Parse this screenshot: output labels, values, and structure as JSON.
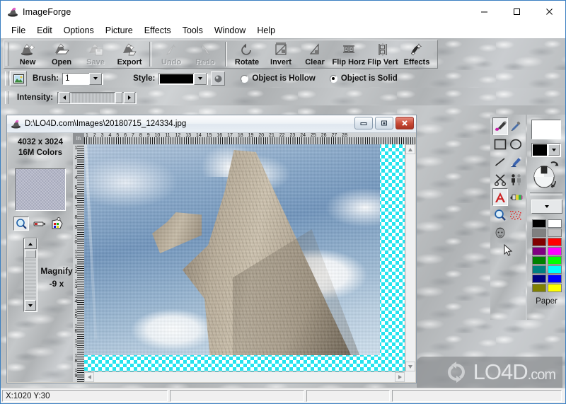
{
  "app": {
    "title": "ImageForge",
    "icon": "imageforge-logo-icon"
  },
  "window_controls": {
    "minimize": "—",
    "maximize": "☐",
    "close": "✕"
  },
  "menu": {
    "items": [
      "File",
      "Edit",
      "Options",
      "Picture",
      "Effects",
      "Tools",
      "Window",
      "Help"
    ]
  },
  "toolbar": {
    "groups": [
      {
        "buttons": [
          {
            "label": "New",
            "icon": "new-document-icon",
            "enabled": true
          },
          {
            "label": "Open",
            "icon": "open-folder-icon",
            "enabled": true
          },
          {
            "label": "Save",
            "icon": "save-disk-icon",
            "enabled": false
          },
          {
            "label": "Export",
            "icon": "export-icon",
            "enabled": true
          }
        ]
      },
      {
        "buttons": [
          {
            "label": "Undo",
            "icon": "undo-arrow-icon",
            "enabled": false
          },
          {
            "label": "Redo",
            "icon": "redo-arrow-icon",
            "enabled": false
          }
        ]
      },
      {
        "buttons": [
          {
            "label": "Rotate",
            "icon": "rotate-icon",
            "enabled": true
          },
          {
            "label": "Invert",
            "icon": "invert-icon",
            "enabled": true
          },
          {
            "label": "Clear",
            "icon": "clear-icon",
            "enabled": true
          },
          {
            "label": "Flip Horz",
            "icon": "flip-horz-icon",
            "enabled": true
          },
          {
            "label": "Flip Vert",
            "icon": "flip-vert-icon",
            "enabled": true
          },
          {
            "label": "Effects",
            "icon": "effects-icon",
            "enabled": true
          }
        ]
      }
    ]
  },
  "options_bar": {
    "preview_icon": "picture-preview-icon",
    "brush_label": "Brush:",
    "brush_value": "1",
    "style_label": "Style:",
    "style_color": "#000000",
    "style_extra_icon": "sphere-shade-icon",
    "object_hollow_label": "Object is Hollow",
    "object_solid_label": "Object is Solid",
    "object_selected": "solid",
    "intensity_label": "Intensity:"
  },
  "child_window": {
    "icon": "imageforge-doc-icon",
    "title": "D:\\LO4D.com\\Images\\20180715_124334.jpg",
    "controls": {
      "minimize": "minimize-icon",
      "maximize": "maximize-icon",
      "close": "close-icon"
    },
    "info": {
      "dimensions": "4032 x 3024",
      "colors": "16M Colors",
      "thumbnail_name": "image-thumbnail",
      "mini_tools": [
        "magnify-tool-icon",
        "pan-hand-icon",
        "palette-picker-icon"
      ],
      "magnify_label": "Magnify",
      "magnify_value": "-9 x"
    },
    "ruler": {
      "unit": "in",
      "h_numbers": "1 2 3 4 5 6 7 8 9 10 11 12 13 14 15 16 17 18 19 20 21 22 23 24 25 26 27 28",
      "v_numbers": "1 2 3 4 5 6 7 8 9 10 11 12 13 14 15 16 17 18 19 20 21 22 23"
    },
    "canvas": {
      "image_description": "stone-monument-obelisk-against-blue-sky-with-clouds",
      "transparent_background": "checkerboard-cyan-white"
    }
  },
  "tool_palette": {
    "tools": [
      {
        "name": "paint-brush-icon",
        "selected": true
      },
      {
        "name": "eyedropper-icon",
        "selected": false
      },
      {
        "name": "rectangle-icon",
        "selected": false
      },
      {
        "name": "ellipse-icon",
        "selected": false
      },
      {
        "name": "line-icon",
        "selected": false
      },
      {
        "name": "spray-can-icon",
        "selected": false
      },
      {
        "name": "scissors-icon",
        "selected": false
      },
      {
        "name": "clone-people-icon",
        "selected": false
      },
      {
        "name": "text-tool-icon",
        "selected": true
      },
      {
        "name": "eraser-icon",
        "selected": false
      },
      {
        "name": "zoom-magnifier-icon",
        "selected": false
      },
      {
        "name": "pattern-dots-icon",
        "selected": false
      },
      {
        "name": "portrait-filter-icon",
        "selected": false
      },
      {
        "name": "cursor-arrow-icon",
        "selected": false
      }
    ]
  },
  "color_panel": {
    "foreground_color": "#ffffff",
    "background_color": "#000000",
    "mouse_icon": "mouse-swap-icon",
    "pattern_dropdown_icon": "chevron-down-icon",
    "swatches": [
      "#000000",
      "#ffffff",
      "#808080",
      "#c0c0c0",
      "#800000",
      "#ff0000",
      "#800080",
      "#ff00ff",
      "#008000",
      "#00ff00",
      "#008080",
      "#00ffff",
      "#000080",
      "#0000ff",
      "#808000",
      "#ffff00"
    ],
    "paper_label": "Paper"
  },
  "status_bar": {
    "coordinates": "X:1020 Y:30",
    "cells": [
      "X:1020 Y:30",
      "",
      "",
      ""
    ]
  },
  "watermark": {
    "text": "LO4D",
    "suffix": ".com",
    "logo": "circular-arrows-icon"
  }
}
